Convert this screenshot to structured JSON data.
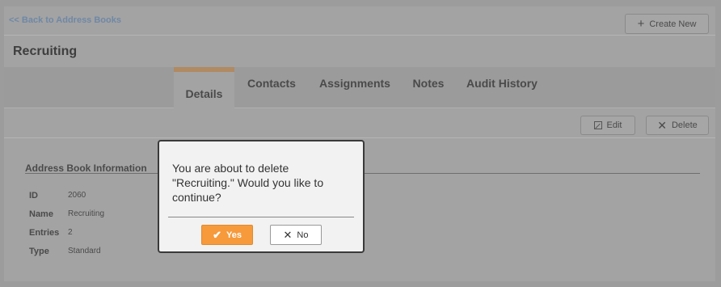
{
  "nav": {
    "back_label": "<< Back to Address Books",
    "create_label": "Create New"
  },
  "page": {
    "title": "Recruiting"
  },
  "tabs": [
    {
      "label": "Details",
      "active": true
    },
    {
      "label": "Contacts",
      "active": false
    },
    {
      "label": "Assignments",
      "active": false
    },
    {
      "label": "Notes",
      "active": false
    },
    {
      "label": "Audit History",
      "active": false
    }
  ],
  "actions": {
    "edit_label": "Edit",
    "delete_label": "Delete"
  },
  "details": {
    "section_title": "Address Book Information",
    "rows": [
      {
        "key": "ID",
        "value": "2060"
      },
      {
        "key": "Name",
        "value": "Recruiting"
      },
      {
        "key": "Entries",
        "value": "2"
      },
      {
        "key": "Type",
        "value": "Standard"
      }
    ]
  },
  "dialog": {
    "message": "You are about to delete \"Recruiting.\" Would you like to continue?",
    "yes_label": "Yes",
    "no_label": "No",
    "accent_color": "#f69a3c"
  },
  "icons": {
    "create": "plus-icon",
    "edit": "edit-icon",
    "delete": "x-icon",
    "yes": "check-icon",
    "no": "close-icon"
  }
}
